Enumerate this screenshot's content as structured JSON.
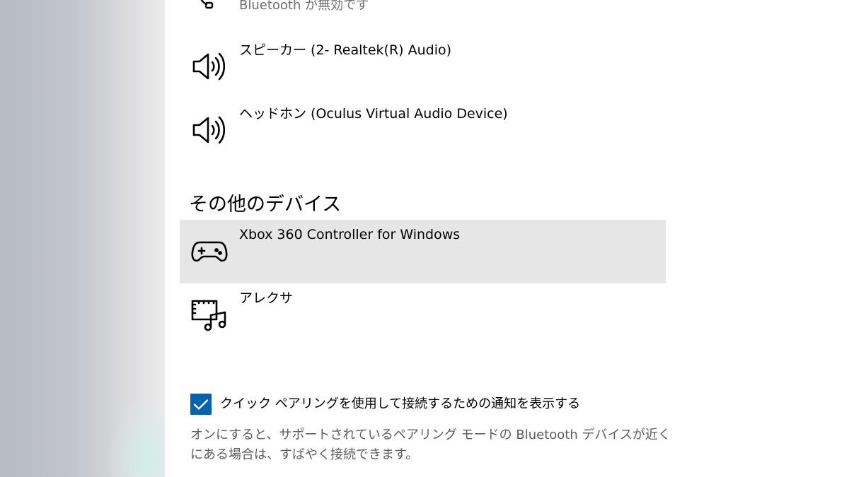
{
  "top_device": {
    "icon": "headset-icon",
    "status": "Bluetooth が無効です"
  },
  "audio_devices": [
    {
      "name": "スピーカー (2- Realtek(R) Audio)",
      "icon": "speaker-icon"
    },
    {
      "name": "ヘッドホン (Oculus Virtual Audio Device)",
      "icon": "speaker-icon"
    }
  ],
  "other_devices": {
    "title": "その他のデバイス",
    "items": [
      {
        "name": "Xbox 360 Controller for Windows",
        "icon": "gamepad-icon",
        "selected": true
      },
      {
        "name": "アレクサ",
        "icon": "media-device-icon",
        "selected": false
      }
    ]
  },
  "quick_pair": {
    "checked": true,
    "label": "クイック ペアリングを使用して接続するための通知を表示する",
    "description": "オンにすると、サポートされているペアリング モードの Bluetooth デバイスが近くにある場合は、すばやく接続できます。"
  },
  "colors": {
    "accent": "#0063b1",
    "selected_row": "#e6e6e6",
    "secondary_text": "#5d5d5d"
  }
}
